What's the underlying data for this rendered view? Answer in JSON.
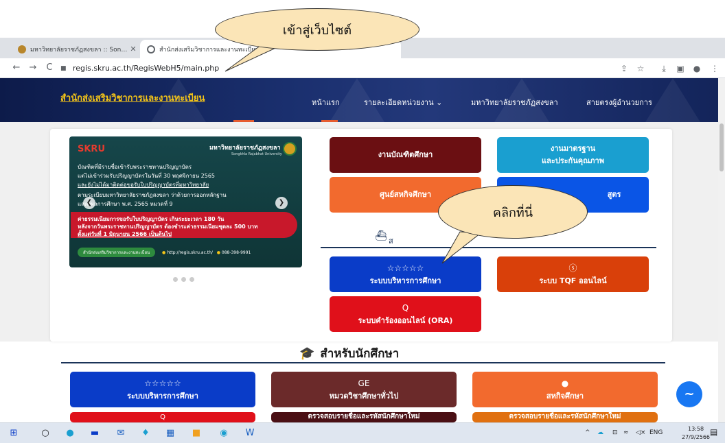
{
  "browser": {
    "tabs": [
      {
        "title": "มหาวิทยาลัยราชภัฏสงขลา :: Songkhla",
        "favicon_color": "#b8862b"
      },
      {
        "title": "สำนักส่งเสริมวิชาการและงานทะเบียน",
        "favicon_color": "#5f6368"
      }
    ],
    "window_controls": [
      "⌄",
      "–",
      "▢",
      "✕"
    ],
    "address": "regis.skru.ac.th/RegisWebH5/main.php"
  },
  "site": {
    "brand": "สำนักส่งเสริมวิชาการและงานทะเบียน",
    "nav": [
      {
        "label": "หน้าแรก"
      },
      {
        "label": "รายละเอียดหน่วยงาน ⌄"
      },
      {
        "label": "มหาวิทยาลัยราชภัฏสงขลา"
      },
      {
        "label": "สายตรงผู้อำนวยการ"
      }
    ]
  },
  "banner": {
    "logo": "SKRU",
    "university": "มหาวิทยาลัยราชภัฏสงขลา",
    "university_en": "Songkhla Rajabhat University",
    "lines": [
      "บัณฑิตที่มีรายชื่อเข้ารับพระราชทานปริญญาบัตร",
      "แต่ไม่เข้าร่วมรับปริญญาบัตรในวันที่ 30 พฤศจิกายน 2565",
      "และยังไม่ได้มาติดต่อขอรับใบปริญญาบัตรที่มหาวิทยาลัย",
      "ตามระเบียบมหาวิทยาลัยราชภัฏสงขลา ว่าด้วยการออกหลักฐาน",
      "แสดงผลการศึกษา พ.ศ. 2565 หมวดที่ 9"
    ],
    "highlight_lines": [
      "ค่าธรรมเนียมการขอรับใบปริญญาบัตร เกินระยะเวลา 180 วัน",
      "หลังจากวันพระราชทานปริญญาบัตร ต้องชำระค่าธรรมเนียมชุดละ 500 บาท",
      "ตั้งแต่วันที่ 1 มิถุนายน 2566 เป็นต้นไป"
    ],
    "footer_pill": "สำนักส่งเสริมวิชาการและงานทะเบียน",
    "footer_url": "http://regis.skru.ac.th/",
    "footer_phone": "088-398-9991",
    "slides": 3
  },
  "services": {
    "graduate": "งานบัณฑิตศึกษา",
    "standard_line1": "งานมาตรฐาน",
    "standard_line2": "และประกันคุณภาพ",
    "coop": "ศูนย์สหกิจศึกษา",
    "curriculum_partial": "สูตร",
    "edu_icon": "☆☆☆☆☆",
    "edu_system": "ระบบบริหารการศึกษา",
    "tqf_icon": "ⓢ",
    "tqf": "ระบบ TQF ออนไลน์",
    "ora_icon": "Q",
    "ora": "ระบบคำร้องออนไลน์ (ORA)"
  },
  "students": {
    "title": "สำหรับนักศึกษา",
    "items": [
      {
        "icon": "☆☆☆☆☆",
        "label": "ระบบบริหารการศึกษา"
      },
      {
        "icon": "GE",
        "label": "หมวดวิชาศึกษาทั่วไป"
      },
      {
        "icon": "●",
        "label": "สหกิจศึกษา"
      },
      {
        "icon": "Q",
        "label": ""
      },
      {
        "icon": "",
        "label": "ตรวจสอบรายชื่อและรหัสนักศึกษาใหม่"
      },
      {
        "icon": "",
        "label": "ตรวจสอบรายชื่อและรหัสนักศึกษาใหม่"
      }
    ]
  },
  "callouts": {
    "enter_site": "เข้าสู่เว็บไซต์",
    "click_here": "คลิกที่นี่"
  },
  "taskbar": {
    "lang": "ENG",
    "time": "13:58",
    "date": "27/9/2566"
  },
  "colors": {
    "header_bg": "#13245a",
    "brand_yellow": "#f5c518",
    "maroon": "#6b0f12",
    "teal": "#1a9fd0",
    "orange": "#f26a2e",
    "blue": "#0a3cc8",
    "red_orange": "#d9400a",
    "red": "#e0101a",
    "brown": "#6b2a2a",
    "amber": "#e07010"
  }
}
